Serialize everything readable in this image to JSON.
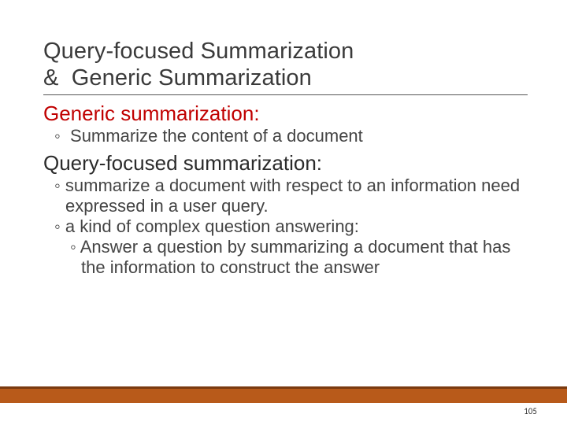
{
  "title_line1": "Query-focused Summarization",
  "title_line2": "&  Generic Summarization",
  "section1": {
    "heading": "Generic summarization:",
    "bullet1": "◦  Summarize the content of a document"
  },
  "section2": {
    "heading": "Query-focused summarization:",
    "bullet1": "◦ summarize a document with respect to an information need expressed in a user query.",
    "bullet2": "◦ a kind of complex question answering:",
    "sub1": "◦ Answer a question by summarizing a document that has the information to construct the answer"
  },
  "page_number": "105"
}
